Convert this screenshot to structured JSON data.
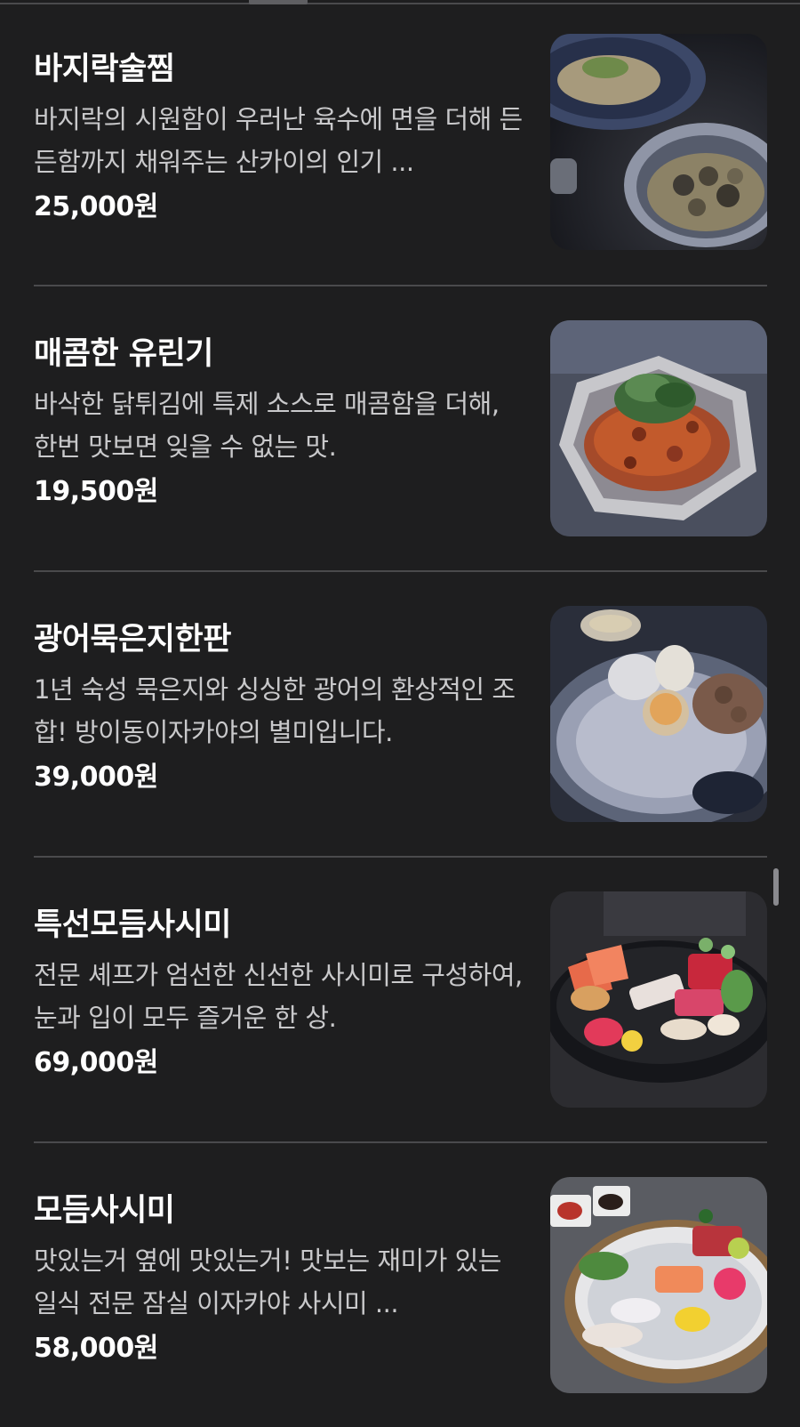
{
  "menu": {
    "items": [
      {
        "name": "바지락술찜",
        "description": "바지락의 시원함이 우러난 육수에 면을 더해 든든함까지 채워주는 산카이의 인기 ...",
        "price": "25,000원",
        "image_icon": "clam-soup-photo"
      },
      {
        "name": "매콤한 유린기",
        "description": "바삭한 닭튀김에 특제 소스로 매콤함을 더해, 한번 맛보면 잊을 수 없는 맛.",
        "price": "19,500원",
        "image_icon": "spicy-chicken-photo"
      },
      {
        "name": "광어묵은지한판",
        "description": "1년 숙성 묵은지와 싱싱한 광어의 환상적인 조합! 방이동이자카야의 별미입니다.",
        "price": "39,000원",
        "image_icon": "flounder-platter-photo"
      },
      {
        "name": "특선모듬사시미",
        "description": "전문 셰프가 엄선한 신선한 사시미로 구성하여, 눈과 입이 모두 즐거운 한 상.",
        "price": "69,000원",
        "image_icon": "premium-sashimi-photo"
      },
      {
        "name": "모듬사시미",
        "description": "맛있는거 옆에 맛있는거! 맛보는 재미가 있는 일식 전문 잠실 이자카야 사시미 ...",
        "price": "58,000원",
        "image_icon": "assorted-sashimi-photo"
      }
    ]
  }
}
